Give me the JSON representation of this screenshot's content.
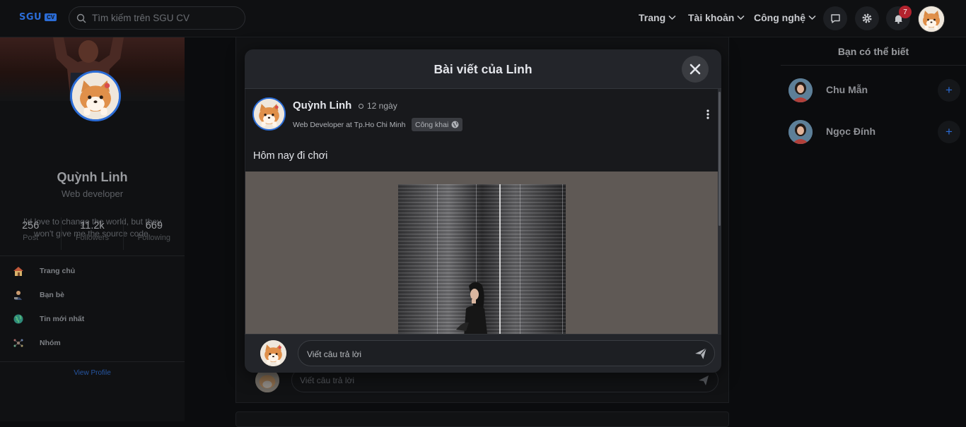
{
  "header": {
    "logo_text": "SGU",
    "logo_badge": "CV",
    "search_placeholder": "Tìm kiếm trên SGU CV",
    "menus": [
      "Trang",
      "Tài khoản",
      "Công nghệ"
    ],
    "notification_count": "7",
    "icons": [
      "message-icon",
      "gear-icon",
      "bell-icon"
    ]
  },
  "profile": {
    "name": "Quỳnh Linh",
    "role": "Web developer",
    "bio": "I'd love to change the world, but they won't give me the source code.",
    "stats": [
      {
        "value": "256",
        "label": "Post"
      },
      {
        "value": "11.2k",
        "label": "Followers"
      },
      {
        "value": "669",
        "label": "Following"
      }
    ],
    "nav": [
      {
        "label": "Trang chủ",
        "icon": "house-icon"
      },
      {
        "label": "Bạn bè",
        "icon": "friends-icon"
      },
      {
        "label": "Tin mới nhất",
        "icon": "globe-icon"
      },
      {
        "label": "Nhóm",
        "icon": "group-icon"
      }
    ],
    "view_profile": "View Profile"
  },
  "background_feed": {
    "reply_placeholder": "Viết câu trả lời"
  },
  "suggestions": {
    "title": "Bạn có thể biết",
    "people": [
      {
        "name": "Chu Mẫn"
      },
      {
        "name": "Ngọc Đính"
      }
    ]
  },
  "modal": {
    "title": "Bài viết của Linh",
    "post": {
      "author": "Quỳnh Linh",
      "time": "12 ngày",
      "subtitle": "Web Developer at Tp.Ho Chi Minh",
      "privacy": "Công khai",
      "text": "Hôm nay đi chơi"
    },
    "reply_placeholder": "Viết câu trả lời"
  },
  "colors": {
    "accent": "#2b6cd6",
    "badge": "#b3232e",
    "modal_bg": "#23252a",
    "page_bg": "#0b0c0e"
  }
}
